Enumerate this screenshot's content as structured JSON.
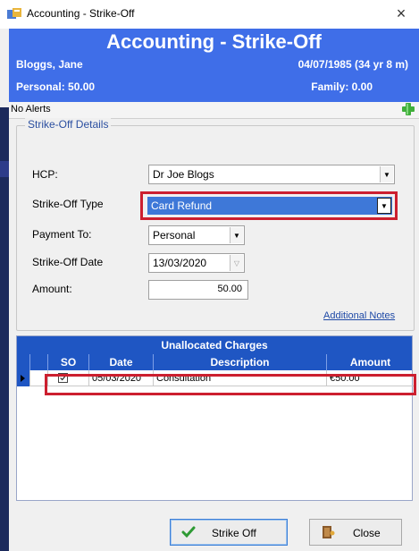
{
  "window": {
    "title": "Accounting - Strike-Off",
    "close_glyph": "×"
  },
  "header": {
    "title": "Accounting - Strike-Off",
    "patient_name": "Bloggs, Jane",
    "dob": "04/07/1985 (34 yr 8 m)",
    "personal": "Personal:   50.00",
    "family": "Family:  0.00",
    "background_color": "#3f6ee8"
  },
  "alerts": {
    "text": "No Alerts",
    "add_icon": "plus-icon"
  },
  "details": {
    "legend": "Strike-Off Details",
    "hcp_label": "HCP:",
    "hcp_value": "Dr Joe Blogs",
    "type_label": "Strike-Off Type",
    "type_value": "Card Refund",
    "payment_label": "Payment To:",
    "payment_value": "Personal",
    "date_label": "Strike-Off Date",
    "date_value": "13/03/2020",
    "amount_label": "Amount:",
    "amount_value": "50.00",
    "notes_link": "Additional Notes"
  },
  "grid": {
    "caption": "Unallocated Charges",
    "columns": [
      "SO",
      "Date",
      "Description",
      "Amount"
    ],
    "rows": [
      {
        "so": true,
        "date": "05/03/2020",
        "description": "Consultation",
        "amount": "€50.00"
      }
    ]
  },
  "buttons": {
    "strike_off": "Strike Off",
    "close": "Close"
  },
  "colors": {
    "highlight_red": "#cc1f2f",
    "grid_header": "#1f56c3",
    "selection_blue": "#3e78d8"
  }
}
